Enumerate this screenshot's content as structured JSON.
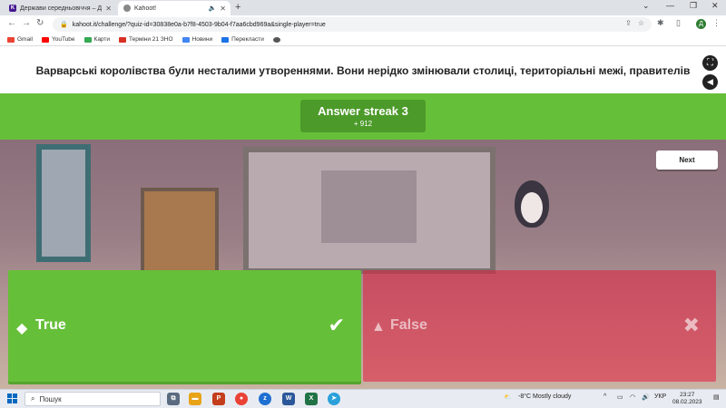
{
  "browser": {
    "tabs": [
      {
        "title": "Держави середньовіччя – Дитя",
        "active": false
      },
      {
        "title": "Kahoot!",
        "active": true
      }
    ],
    "address": "kahoot.it/challenge/?quiz-id=30838e0a-b7f8-4503-9b04-f7aa6cbd969a&single-player=true",
    "bookmarks": [
      "Gmail",
      "YouTube",
      "Карти",
      "Терміни 21 ЗНО",
      "Новини",
      "Перекласти"
    ],
    "profile_initial": "Д"
  },
  "game": {
    "question": "Варварські королівства були несталими утвореннями. Вони нерідко змінювали столиці, територіальні межі, правителів",
    "streak_title": "Answer streak 3",
    "points": "+ 912",
    "next_label": "Next",
    "answers": [
      {
        "label": "True",
        "shape": "diamond",
        "correct": true
      },
      {
        "label": "False",
        "shape": "triangle",
        "correct": false
      }
    ],
    "colors": {
      "correct": "#66bf39",
      "incorrect": "#e21b3c",
      "streak_bar": "#66bf39"
    }
  },
  "taskbar": {
    "search_placeholder": "Пошук",
    "weather": "-8°C  Mostly cloudy",
    "language": "УКР",
    "time": "23:27",
    "date": "08.02.2023"
  }
}
